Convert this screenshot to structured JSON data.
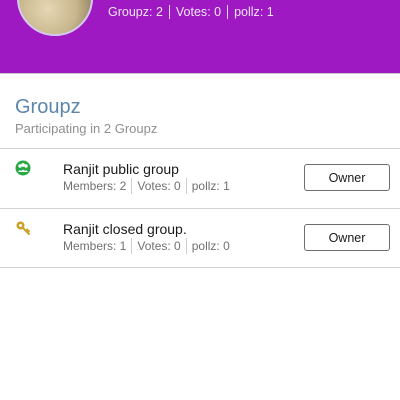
{
  "header": {
    "stats": [
      {
        "label": "Groupz",
        "value": "2"
      },
      {
        "label": "Votes",
        "value": "0"
      },
      {
        "label": "pollz",
        "value": "1"
      }
    ]
  },
  "section": {
    "title": "Groupz",
    "subtitle": "Participating in 2 Groupz"
  },
  "groups": [
    {
      "icon": "public-group-icon",
      "name": "Ranjit public group",
      "stats": {
        "members": "Members: 2",
        "votes": "Votes: 0",
        "pollz": "pollz: 1"
      },
      "role": "Owner"
    },
    {
      "icon": "closed-group-key-icon",
      "name": "Ranjit closed group.",
      "stats": {
        "members": "Members: 1",
        "votes": "Votes: 0",
        "pollz": "pollz: 0"
      },
      "role": "Owner"
    }
  ],
  "colors": {
    "header_bg": "#9e19c2",
    "section_title": "#5c86a9",
    "public_icon": "#27a844",
    "key_icon": "#c9a227"
  }
}
